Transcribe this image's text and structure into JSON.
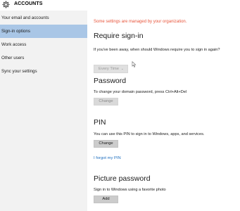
{
  "window": {
    "title": "ACCOUNTS",
    "icon": "gear-icon"
  },
  "sidebar": {
    "items": [
      {
        "label": "Your email and accounts",
        "selected": false
      },
      {
        "label": "Sign-in options",
        "selected": true
      },
      {
        "label": "Work access",
        "selected": false
      },
      {
        "label": "Other users",
        "selected": false
      },
      {
        "label": "Sync your settings",
        "selected": false
      }
    ]
  },
  "main": {
    "notice": "Some settings are managed by your organization.",
    "require_signin": {
      "heading": "Require sign-in",
      "description": "If you've been away, when should Windows require you to sign in again?",
      "dropdown_value": "Every Time"
    },
    "password": {
      "heading": "Password",
      "description": "To change your domain password, press Ctrl+Alt+Del",
      "button": "Change"
    },
    "pin": {
      "heading": "PIN",
      "description": "You can use this PIN to sign in to Windows, apps, and services.",
      "button": "Change",
      "link": "I forgot my PIN"
    },
    "picture_password": {
      "heading": "Picture password",
      "description": "Sign in to Windows using a favorite photo",
      "button": "Add"
    }
  },
  "colors": {
    "accent_selected": "#a9c6e6",
    "notice": "#e8543a",
    "link": "#1f6fbf",
    "sidebar_bg": "#f2f2f2"
  }
}
